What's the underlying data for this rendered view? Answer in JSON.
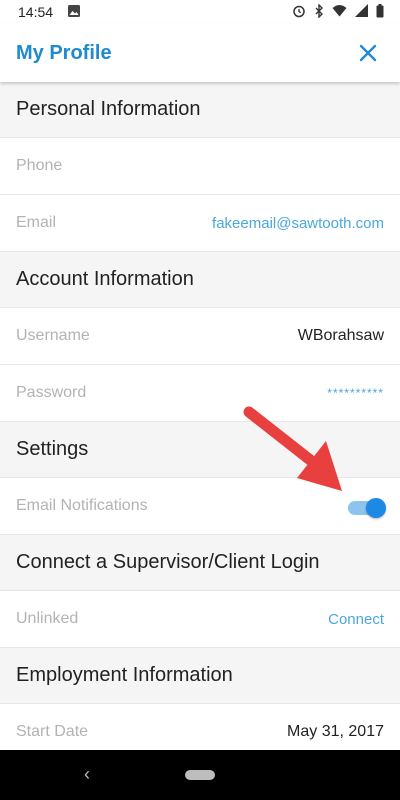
{
  "status_bar": {
    "time": "14:54",
    "icons": [
      "image-icon",
      "alarm-icon",
      "bluetooth-icon",
      "wifi-icon",
      "signal-icon",
      "battery-icon"
    ]
  },
  "app_bar": {
    "title": "My Profile",
    "close_icon": "close-icon",
    "accent_color": "#1f8ad1"
  },
  "sections": {
    "personal": {
      "header": "Personal Information",
      "phone": {
        "label": "Phone",
        "value": ""
      },
      "email": {
        "label": "Email",
        "value": "fakeemail@sawtooth.com"
      }
    },
    "account": {
      "header": "Account Information",
      "username": {
        "label": "Username",
        "value": "WBorahsaw"
      },
      "password": {
        "label": "Password",
        "value": "**********"
      }
    },
    "settings": {
      "header": "Settings",
      "email_notifications": {
        "label": "Email Notifications",
        "enabled": true
      }
    },
    "connect": {
      "header": "Connect a Supervisor/Client Login",
      "status": {
        "label": "Unlinked",
        "action": "Connect"
      }
    },
    "employment": {
      "header": "Employment Information",
      "start_date": {
        "label": "Start Date",
        "value": "May 31, 2017"
      }
    }
  },
  "annotation": {
    "arrow_color": "#e8403f"
  },
  "nav_bar": {
    "back_icon": "back-icon",
    "home_icon": "home-pill-icon"
  }
}
